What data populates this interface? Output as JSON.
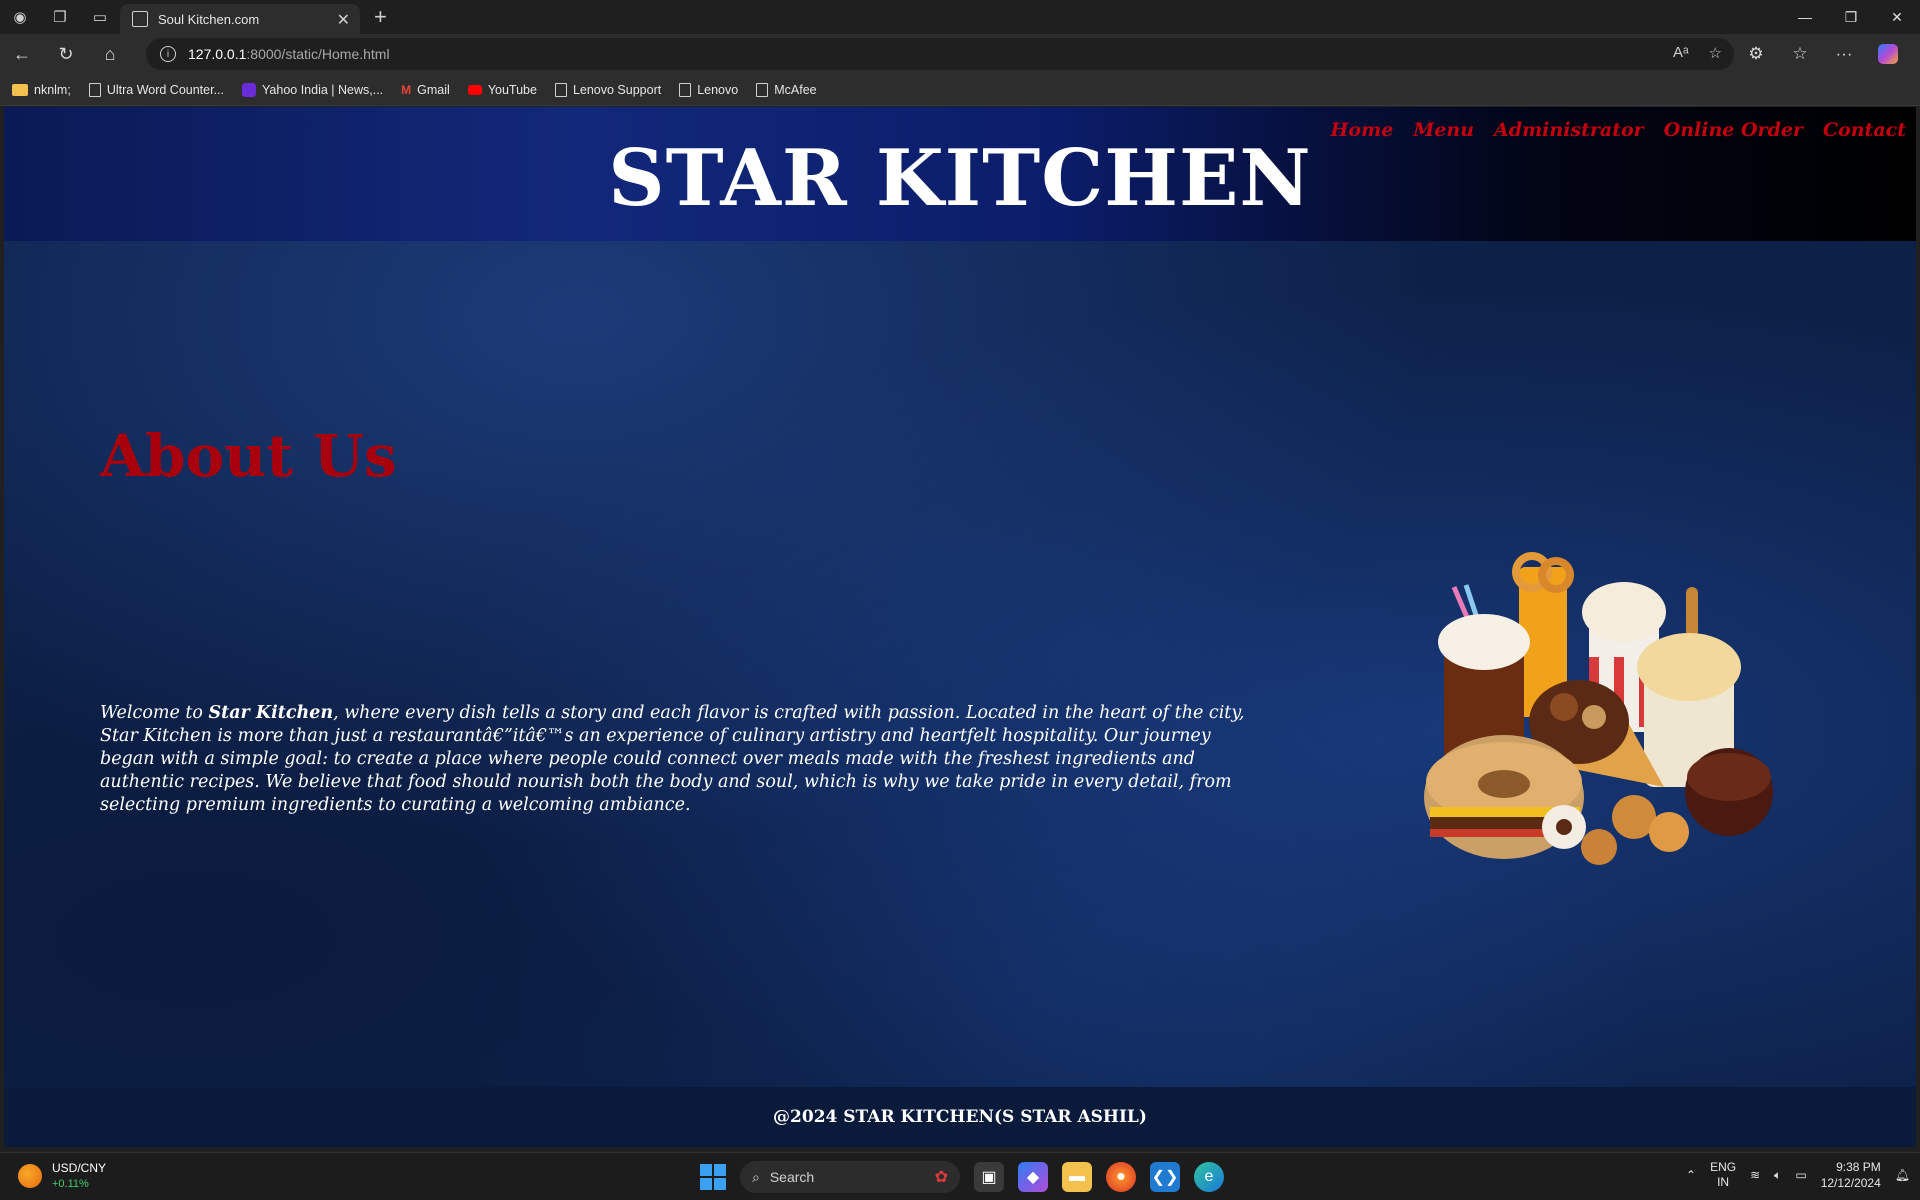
{
  "browser": {
    "tab_title": "Soul Kitchen.com",
    "url_host": "127.0.0.1",
    "url_path": ":8000/static/Home.html",
    "bookmarks": [
      "nknlm;",
      "Ultra Word Counter...",
      "Yahoo India | News,...",
      "Gmail",
      "YouTube",
      "Lenovo Support",
      "Lenovo",
      "McAfee"
    ]
  },
  "site": {
    "title": "STAR KITCHEN",
    "nav": [
      "Home",
      "Menu",
      "Administrator",
      "Online Order",
      "Contact"
    ],
    "about_title": "About Us",
    "about_intro": "Welcome to ",
    "about_brand": "Star Kitchen",
    "about_body": ", where every dish tells a story and each flavor is crafted with passion. Located in the heart of the city, Star Kitchen is more than just a restaurantâ€”itâ€™s an experience of culinary artistry and heartfelt hospitality. Our journey began with a simple goal: to create a place where people could connect over meals made with the freshest ingredients and authentic recipes. We believe that food should nourish both the body and soul, which is why we take pride in every detail, from selecting premium ingredients to curating a welcoming ambiance.",
    "footer": "@2024 STAR KITCHEN(S STAR ASHIL)"
  },
  "taskbar": {
    "widget_title": "USD/CNY",
    "widget_value": "+0.11%",
    "search_placeholder": "Search",
    "lang_top": "ENG",
    "lang_bottom": "IN",
    "time": "9:38 PM",
    "date": "12/12/2024"
  }
}
